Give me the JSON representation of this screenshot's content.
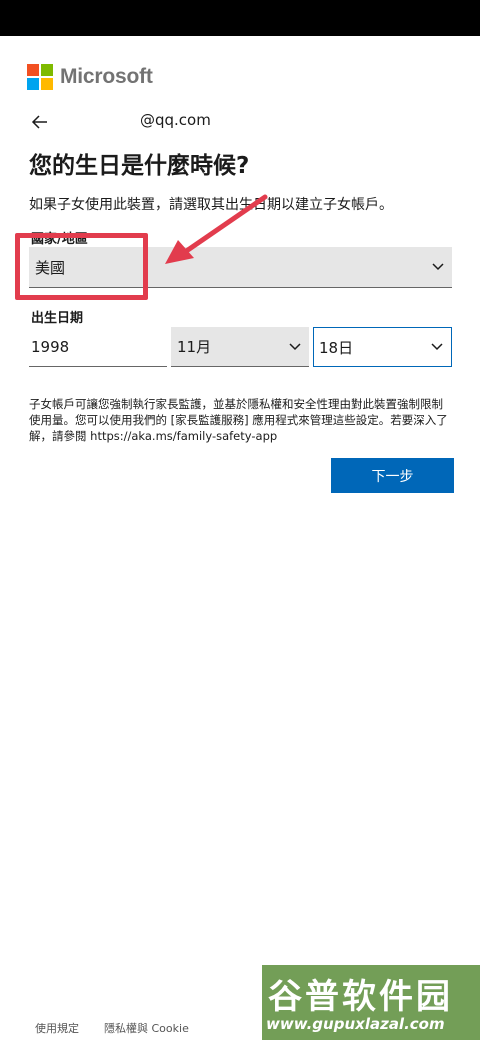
{
  "brand": {
    "name": "Microsoft",
    "colors": [
      "#f25022",
      "#7fba00",
      "#00a4ef",
      "#ffb900"
    ]
  },
  "header": {
    "back_icon": "arrow-left-icon",
    "email": "@qq.com"
  },
  "main": {
    "title": "您的生日是什麼時候?",
    "description": "如果子女使用此裝置，請選取其出生日期以建立子女帳戶。",
    "country_label": "國家/地區",
    "country_value": "美國",
    "dob_label": "出生日期",
    "year_value": "1998",
    "month_value": "11月",
    "day_value": "18日",
    "info_text": "子女帳戶可讓您強制執行家長監護，並基於隱私權和安全性理由對此裝置強制限制使用量。您可以使用我們的 [家長監護服務] 應用程式來管理這些設定。若要深入了解，請參閱 https://aka.ms/family-safety-app",
    "next_button": "下一步"
  },
  "footer": {
    "terms": "使用規定",
    "privacy": "隱私權與 Cookie"
  },
  "watermark": {
    "title": "谷普软件园",
    "url": "www.gupuxlazal.com"
  },
  "colors": {
    "accent": "#0067b8",
    "annotation": "#e23c4d"
  }
}
